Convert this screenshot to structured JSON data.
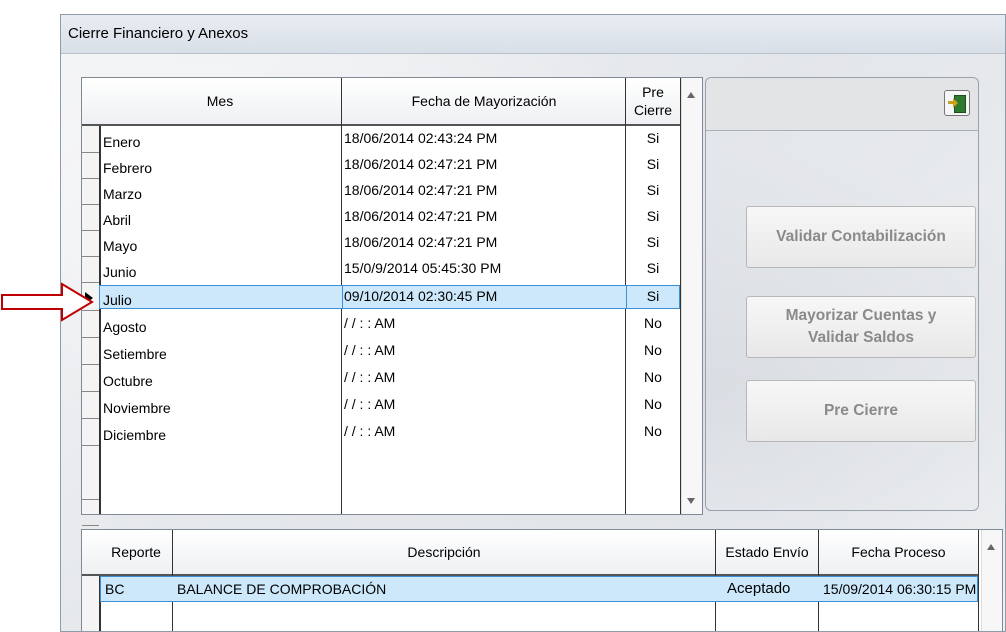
{
  "window": {
    "title": "Cierre Financiero y Anexos"
  },
  "months_grid": {
    "headers": {
      "mes": "Mes",
      "fecha": "Fecha de Mayorización",
      "pre_cierre": "Pre\nCierre"
    },
    "rows": [
      {
        "mes": "Enero",
        "fecha": "18/06/2014 02:43:24 PM",
        "pre": "Si"
      },
      {
        "mes": "Febrero",
        "fecha": "18/06/2014 02:47:21 PM",
        "pre": "Si"
      },
      {
        "mes": "Marzo",
        "fecha": "18/06/2014 02:47:21 PM",
        "pre": "Si"
      },
      {
        "mes": "Abril",
        "fecha": "18/06/2014 02:47:21 PM",
        "pre": "Si"
      },
      {
        "mes": "Mayo",
        "fecha": "18/06/2014 02:47:21 PM",
        "pre": "Si"
      },
      {
        "mes": "Junio",
        "fecha": "15/0/9/2014 05:45:30 PM",
        "pre": "Si"
      },
      {
        "mes": "Julio",
        "fecha": "09/10/2014 02:30:45 PM",
        "pre": "Si"
      },
      {
        "mes": "Agosto",
        "fecha": "/ /      : :  AM",
        "pre": "No"
      },
      {
        "mes": "Setiembre",
        "fecha": "/ /      : :  AM",
        "pre": "No"
      },
      {
        "mes": "Octubre",
        "fecha": "/ /      : :  AM",
        "pre": "No"
      },
      {
        "mes": "Noviembre",
        "fecha": "/ /      : :  AM",
        "pre": "No"
      },
      {
        "mes": "Diciembre",
        "fecha": "/ /      : :  AM",
        "pre": "No"
      }
    ]
  },
  "actions": {
    "validar": "Validar Contabilización",
    "mayorizar_line1": "Mayorizar Cuentas y",
    "mayorizar_line2": "Validar Saldos",
    "pre_cierre": "Pre Cierre"
  },
  "reports_grid": {
    "headers": {
      "reporte": "Reporte",
      "descripcion": "Descripción",
      "estado": "Estado Envío",
      "fecha": "Fecha Proceso"
    },
    "rows": [
      {
        "reporte": "BC",
        "descripcion": "BALANCE DE COMPROBACIÓN",
        "estado": "Aceptado",
        "fecha": "15/09/2014  06:30:15 PM"
      }
    ]
  },
  "colors": {
    "selection": "#cde8fb",
    "selection_border": "#3c8fd6",
    "callout_arrow": "#c00000"
  }
}
